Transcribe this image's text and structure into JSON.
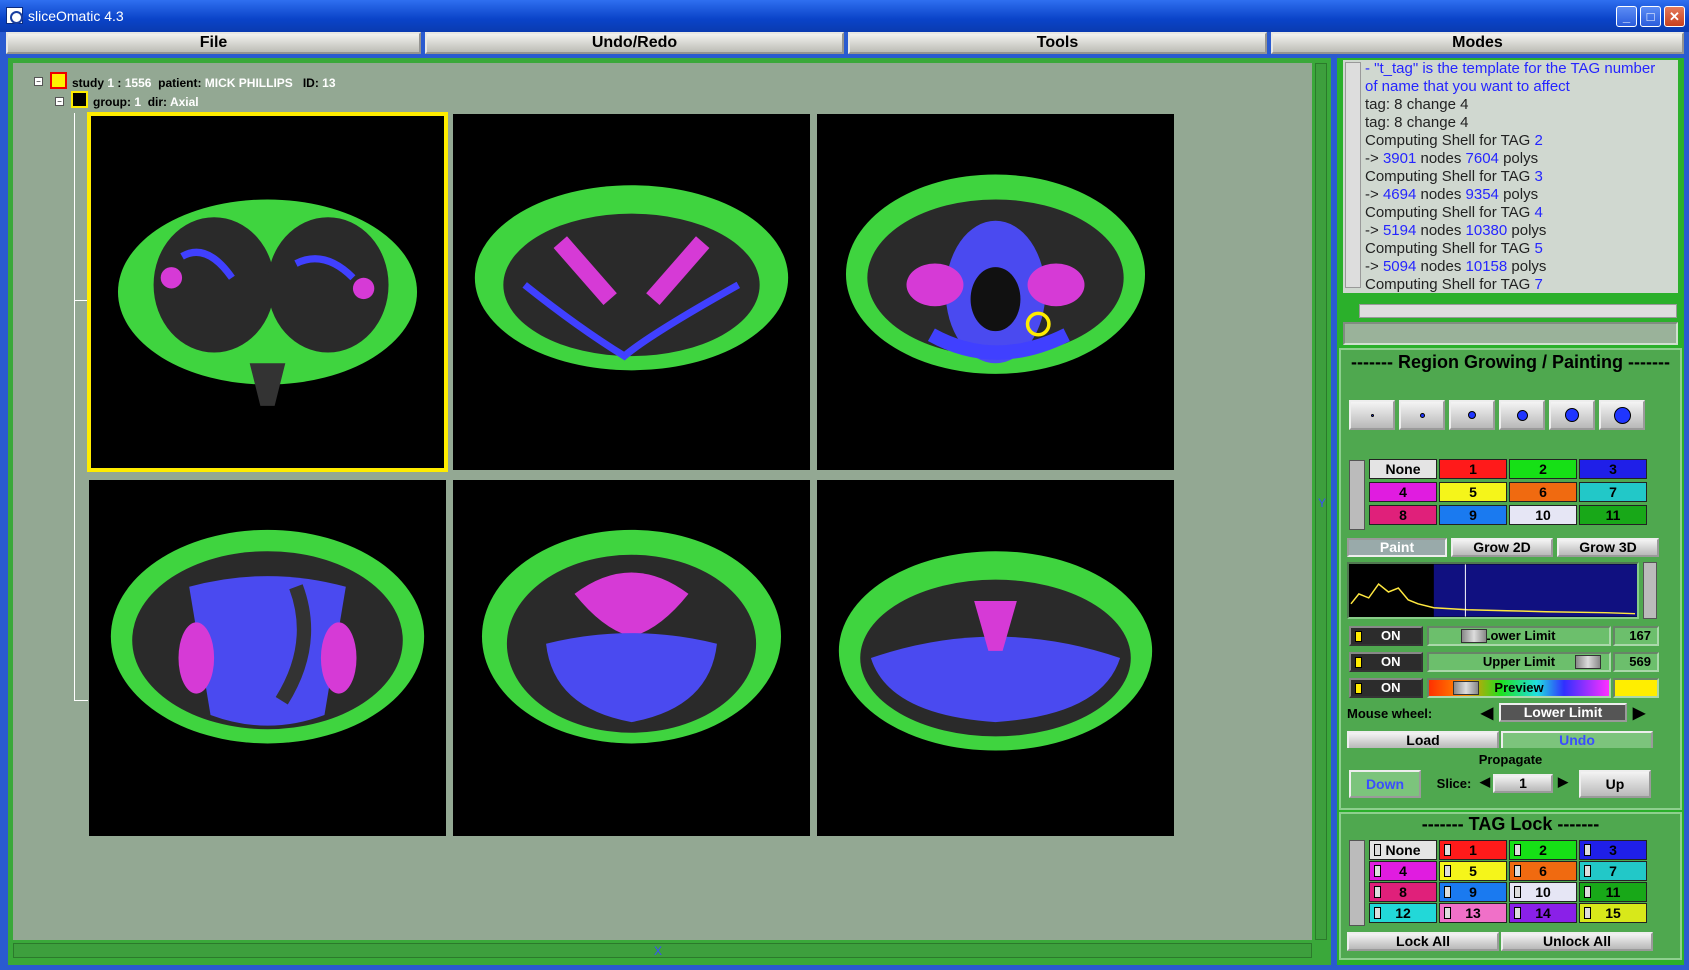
{
  "window": {
    "title": "sliceOmatic 4.3",
    "min": "_",
    "max": "□",
    "close": "✕"
  },
  "menu": [
    "File",
    "Undo/Redo",
    "Tools",
    "Modes"
  ],
  "tree": {
    "study_label": "study",
    "study_num": "1",
    "study_sep": ":",
    "study_id": "1556",
    "patient_label": "patient:",
    "patient_name": "MICK PHILLIPS",
    "id_label": "ID:",
    "id_value": "13",
    "group_label": "group:",
    "group_num": "1",
    "dir_label": "dir:",
    "dir_value": "Axial"
  },
  "scroll": {
    "y_label": "Y",
    "x_label": "X"
  },
  "log": {
    "lines": [
      {
        "t": "- \"t_tag\" is the template for the TAG number",
        "blue": true
      },
      {
        "t": "  of name that you want to affect",
        "blue": true
      },
      {
        "t": "tag: 8 change 4"
      },
      {
        "t": "tag: 8 change 4"
      },
      {
        "a": "Computing Shell for TAG ",
        "b": "2"
      },
      {
        "a": "-> ",
        "b": "3901",
        "c": " nodes ",
        "d": "7604",
        "e": " polys"
      },
      {
        "a": "Computing Shell for TAG ",
        "b": "3"
      },
      {
        "a": "-> ",
        "b": "4694",
        "c": " nodes ",
        "d": "9354",
        "e": " polys"
      },
      {
        "a": "Computing Shell for TAG ",
        "b": "4"
      },
      {
        "a": "-> ",
        "b": "5194",
        "c": " nodes ",
        "d": "10380",
        "e": " polys"
      },
      {
        "a": "Computing Shell for TAG ",
        "b": "5"
      },
      {
        "a": "-> ",
        "b": "5094",
        "c": " nodes ",
        "d": "10158",
        "e": " polys"
      },
      {
        "a": "Computing Shell for TAG ",
        "b": "7"
      }
    ]
  },
  "region": {
    "title": "------- Region Growing / Painting -------",
    "tags": [
      {
        "label": "None",
        "color": "#e4e4e4"
      },
      {
        "label": "1",
        "color": "#ff1a1a"
      },
      {
        "label": "2",
        "color": "#16e016"
      },
      {
        "label": "3",
        "color": "#1f1fe8"
      },
      {
        "label": "4",
        "color": "#e01ce0"
      },
      {
        "label": "5",
        "color": "#f5f51a"
      },
      {
        "label": "6",
        "color": "#f06a10"
      },
      {
        "label": "7",
        "color": "#22c8c8"
      },
      {
        "label": "8",
        "color": "#e0207a"
      },
      {
        "label": "9",
        "color": "#1a7af0"
      },
      {
        "label": "10",
        "color": "#e6e6f5"
      },
      {
        "label": "11",
        "color": "#18a818"
      }
    ],
    "modes": [
      "Paint",
      "Grow 2D",
      "Grow 3D"
    ],
    "on_label": "ON",
    "lower_limit": {
      "label": "Lower Limit",
      "value": "167"
    },
    "upper_limit": {
      "label": "Upper Limit",
      "value": "569"
    },
    "preview_label": "Preview",
    "mouse_wheel_label": "Mouse wheel:",
    "mouse_wheel_value": "Lower Limit",
    "load": "Load",
    "undo": "Undo",
    "propagate": "Propagate",
    "down": "Down",
    "slice_label": "Slice:",
    "slice_value": "1",
    "up": "Up"
  },
  "taglock": {
    "title": "------- TAG Lock -------",
    "tags": [
      {
        "label": "None",
        "color": "#e4e4e4"
      },
      {
        "label": "1",
        "color": "#ff1a1a"
      },
      {
        "label": "2",
        "color": "#16e016"
      },
      {
        "label": "3",
        "color": "#1f1fe8"
      },
      {
        "label": "4",
        "color": "#e01ce0"
      },
      {
        "label": "5",
        "color": "#f5f51a"
      },
      {
        "label": "6",
        "color": "#f06a10"
      },
      {
        "label": "7",
        "color": "#22c8c8"
      },
      {
        "label": "8",
        "color": "#e0207a"
      },
      {
        "label": "9",
        "color": "#1a7af0"
      },
      {
        "label": "10",
        "color": "#e6e6f5"
      },
      {
        "label": "11",
        "color": "#18a818"
      },
      {
        "label": "12",
        "color": "#22d8d8"
      },
      {
        "label": "13",
        "color": "#f070c8"
      },
      {
        "label": "14",
        "color": "#8a20e8"
      },
      {
        "label": "15",
        "color": "#d8e81a"
      }
    ],
    "lock_all": "Lock All",
    "unlock_all": "Unlock All"
  }
}
